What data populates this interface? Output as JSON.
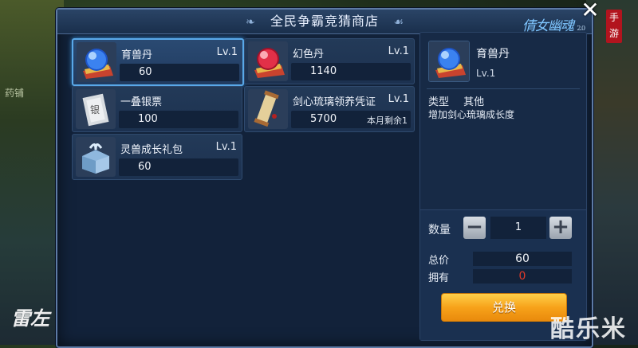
{
  "shop": {
    "title": "全民争霸竞猜商店",
    "logo_text": "倩女幽魂",
    "logo_version": "2.0",
    "logo_seal": "手游",
    "close_glyph": "✕"
  },
  "background": {
    "left_sign": "药铺",
    "calligraphy": "雷左"
  },
  "items": [
    {
      "name": "育兽丹",
      "level": "Lv.1",
      "price": "60",
      "icon": "blue-orb-icon",
      "selected": true,
      "remaining": ""
    },
    {
      "name": "幻色丹",
      "level": "Lv.1",
      "price": "1140",
      "icon": "red-orb-icon",
      "selected": false,
      "remaining": ""
    },
    {
      "name": "一叠银票",
      "level": "",
      "price": "100",
      "icon": "silver-note-icon",
      "selected": false,
      "remaining": ""
    },
    {
      "name": "剑心琉璃领养凭证",
      "level": "Lv.1",
      "price": "5700",
      "icon": "scroll-icon",
      "selected": false,
      "remaining": "本月剩余1"
    },
    {
      "name": "灵兽成长礼包",
      "level": "Lv.1",
      "price": "60",
      "icon": "gift-package-icon",
      "selected": false,
      "remaining": ""
    }
  ],
  "detail": {
    "name": "育兽丹",
    "level": "Lv.1",
    "type_label": "类型",
    "type_value": "其他",
    "description": "增加剑心琉璃成长度",
    "quantity_label": "数量",
    "quantity": "1",
    "minus_glyph": "−",
    "plus_glyph": "+",
    "total_label": "总价",
    "total": "60",
    "owned_label": "拥有",
    "owned": "0",
    "exchange_label": "兑换"
  },
  "colors": {
    "accent": "#59a8e8",
    "owned": "#e03a2a",
    "exchange_button": "#f7a21a"
  },
  "watermark": "酷乐米"
}
